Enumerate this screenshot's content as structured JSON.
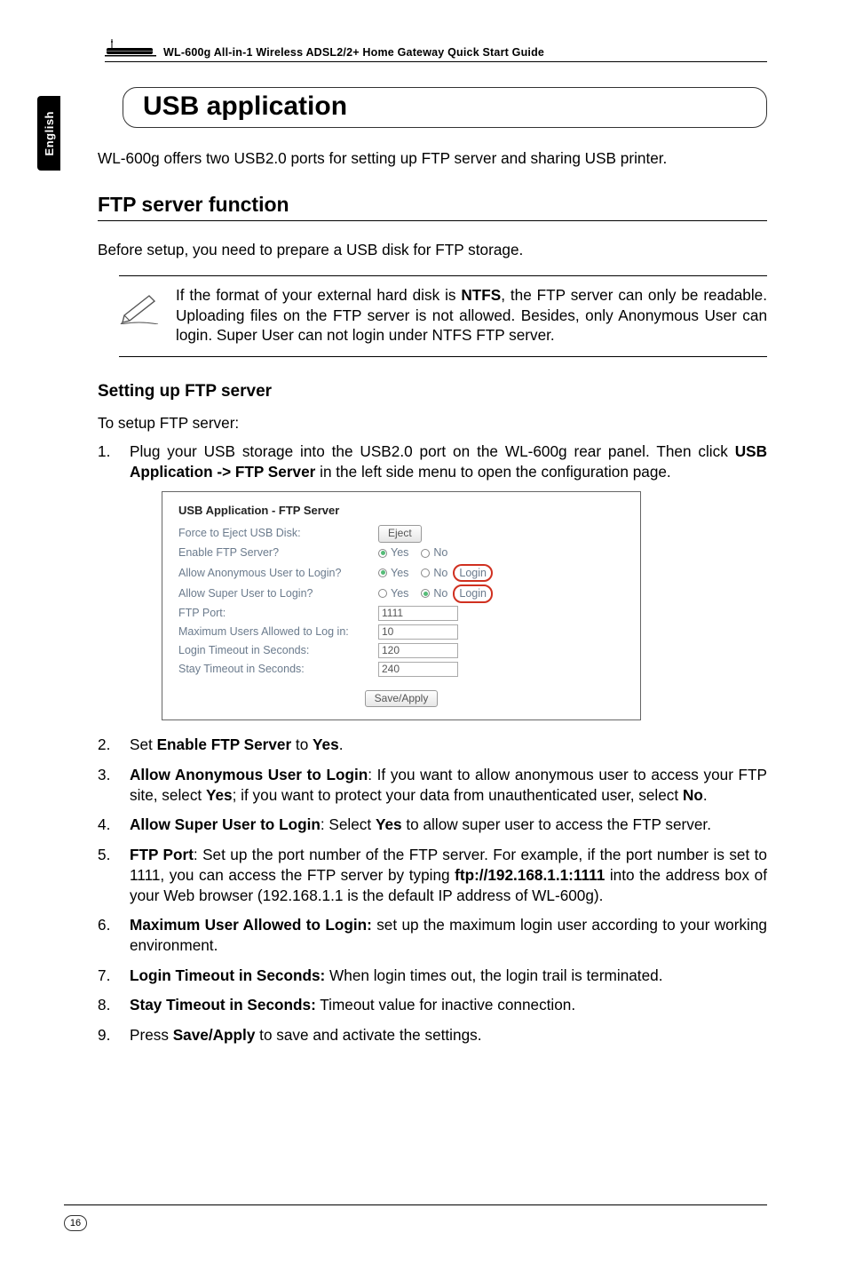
{
  "header": {
    "doc_title": "WL-600g All-in-1 Wireless ADSL2/2+ Home Gateway Quick Start Guide"
  },
  "side_tab": "English",
  "title": "USB application",
  "intro": "WL-600g offers two USB2.0 ports for setting up FTP server and sharing USB printer.",
  "section_heading": "FTP server function",
  "before_setup": "Before setup, you need to prepare a USB disk for FTP storage.",
  "note": {
    "pre": "If the format of your external hard disk is ",
    "b1": "NTFS",
    "post": ", the FTP server can only be readable. Uploading files on the FTP server is not allowed. Besides, only Anonymous User can login. Super User can not login under NTFS FTP server."
  },
  "sub_heading": "Setting up FTP server",
  "to_setup": "To setup FTP server:",
  "step1": {
    "pre": "Plug your USB storage into the USB2.0 port on the WL-600g rear panel. Then click ",
    "b1": "USB Application -> FTP Server",
    "post": " in the left side menu to open the configuration page."
  },
  "screenshot": {
    "title": "USB Application - FTP Server",
    "rows": {
      "eject_label": "Force to Eject USB Disk:",
      "eject_btn": "Eject",
      "enable_label": "Enable FTP Server?",
      "anon_label": "Allow Anonymous User to Login?",
      "super_label": "Allow Super User to Login?",
      "port_label": "FTP Port:",
      "port_val": "1111",
      "max_label": "Maximum Users Allowed to Log in:",
      "max_val": "10",
      "login_to_label": "Login Timeout in Seconds:",
      "login_to_val": "120",
      "stay_to_label": "Stay Timeout in Seconds:",
      "stay_to_val": "240",
      "yes": "Yes",
      "no": "No",
      "login_ring": "Login",
      "save_btn": "Save/Apply"
    }
  },
  "step2": {
    "pre": "Set ",
    "b1": "Enable FTP Server",
    "mid": " to ",
    "b2": "Yes",
    "post": "."
  },
  "step3": {
    "b1": "Allow Anonymous User to Login",
    "mid1": ": If you want to allow anonymous user to access your FTP site, select ",
    "b2": "Yes",
    "mid2": "; if you want to protect your data from unauthenticated user, select ",
    "b3": "No",
    "post": "."
  },
  "step4": {
    "b1": "Allow Super User to Login",
    "mid1": ": Select ",
    "b2": "Yes",
    "post": " to allow super user to access the FTP server."
  },
  "step5": {
    "b1": "FTP Port",
    "mid1": ": Set up the port number of the FTP server. For example, if the port number is set to 1111, you can access the FTP server by typing ",
    "b2": "ftp://192.168.1.1:1111",
    "post": " into the address box of your Web browser (192.168.1.1 is the default IP address of WL-600g)."
  },
  "step6": {
    "b1": "Maximum User Allowed to Login:",
    "post": " set up the maximum login user according to your working environment."
  },
  "step7": {
    "b1": "Login Timeout in Seconds:",
    "post": " When login times out, the login trail is terminated."
  },
  "step8": {
    "b1": "Stay Timeout in Seconds:",
    "post": " Timeout value for inactive connection."
  },
  "step9": {
    "pre": "Press ",
    "b1": "Save/Apply",
    "post": " to save and activate the settings."
  },
  "page_number": "16"
}
